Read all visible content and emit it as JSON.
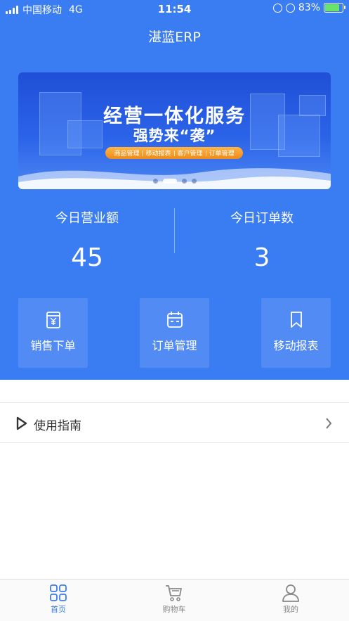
{
  "status_bar": {
    "carrier": "中国移动",
    "network": "4G",
    "time": "11:54",
    "battery": "83%",
    "battery_level": 0.83
  },
  "header": {
    "title": "湛蓝ERP"
  },
  "banner": {
    "line1": "经营一体化服务",
    "line2": "强势来“袭”",
    "features": [
      "商品管理",
      "移动报表",
      "客户管理",
      "订单管理"
    ],
    "dots": 4,
    "active_dot": 1
  },
  "stats": {
    "revenue": {
      "label": "今日营业额",
      "value": "45"
    },
    "orders": {
      "label": "今日订单数",
      "value": "3"
    }
  },
  "quick_actions": [
    {
      "label": "销售下单",
      "icon": "yen-receipt-icon"
    },
    {
      "label": "订单管理",
      "icon": "calendar-icon"
    },
    {
      "label": "移动报表",
      "icon": "bookmark-icon"
    }
  ],
  "guide": {
    "label": "使用指南",
    "icon": "play-icon"
  },
  "tabbar": [
    {
      "label": "首页",
      "icon": "grid-icon",
      "active": true
    },
    {
      "label": "购物车",
      "icon": "cart-icon",
      "active": false
    },
    {
      "label": "我的",
      "icon": "user-icon",
      "active": false
    }
  ],
  "colors": {
    "primary": "#3a7cf2",
    "accent_orange": "#f08a17"
  }
}
